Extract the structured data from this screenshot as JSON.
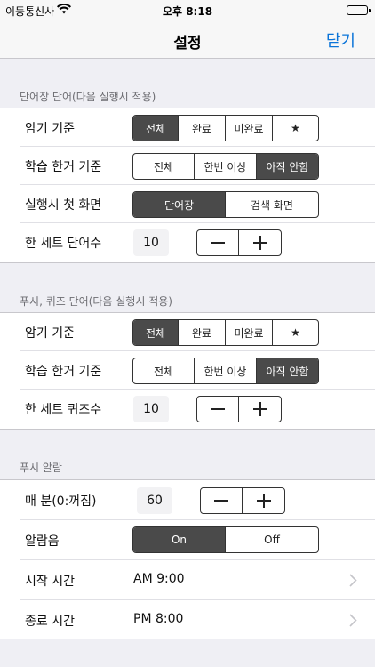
{
  "status_bar": {
    "carrier": "이동통신사",
    "time": "오후 8:18"
  },
  "nav": {
    "title": "설정",
    "close_label": "닫기"
  },
  "icons": {
    "wifi": "wifi-icon",
    "battery": "battery-icon",
    "minus": "minus-icon",
    "plus": "plus-icon",
    "chevron": "chevron-right-icon"
  },
  "sections": {
    "word": {
      "header": "단어장 단어(다음 실행시 적용)",
      "memorize": {
        "label": "암기 기준",
        "options": [
          "전체",
          "완료",
          "미완료",
          "★"
        ],
        "selected": "전체"
      },
      "study": {
        "label": "학습 한거 기준",
        "options": [
          "전체",
          "한번 이상",
          "아직 안함"
        ],
        "selected": "아직 안함"
      },
      "startup": {
        "label": "실행시 첫 화면",
        "options": [
          "단어장",
          "검색 화면"
        ],
        "selected": "단어장"
      },
      "set_count": {
        "label": "한 세트 단어수",
        "value": "10"
      }
    },
    "quiz": {
      "header": "푸시, 퀴즈 단어(다음 실행시 적용)",
      "memorize": {
        "label": "암기 기준",
        "options": [
          "전체",
          "완료",
          "미완료",
          "★"
        ],
        "selected": "전체"
      },
      "study": {
        "label": "학습 한거 기준",
        "options": [
          "전체",
          "한번 이상",
          "아직 안함"
        ],
        "selected": "아직 안함"
      },
      "set_count": {
        "label": "한 세트 퀴즈수",
        "value": "10"
      }
    },
    "push": {
      "header": "푸시 알람",
      "interval": {
        "label": "매 분(0:꺼짐)",
        "value": "60"
      },
      "sound": {
        "label": "알람음",
        "options": [
          "On",
          "Off"
        ],
        "selected": "On"
      },
      "start_time": {
        "label": "시작 시간",
        "value": "AM 9:00"
      },
      "end_time": {
        "label": "종료 시간",
        "value": "PM 8:00"
      }
    }
  }
}
